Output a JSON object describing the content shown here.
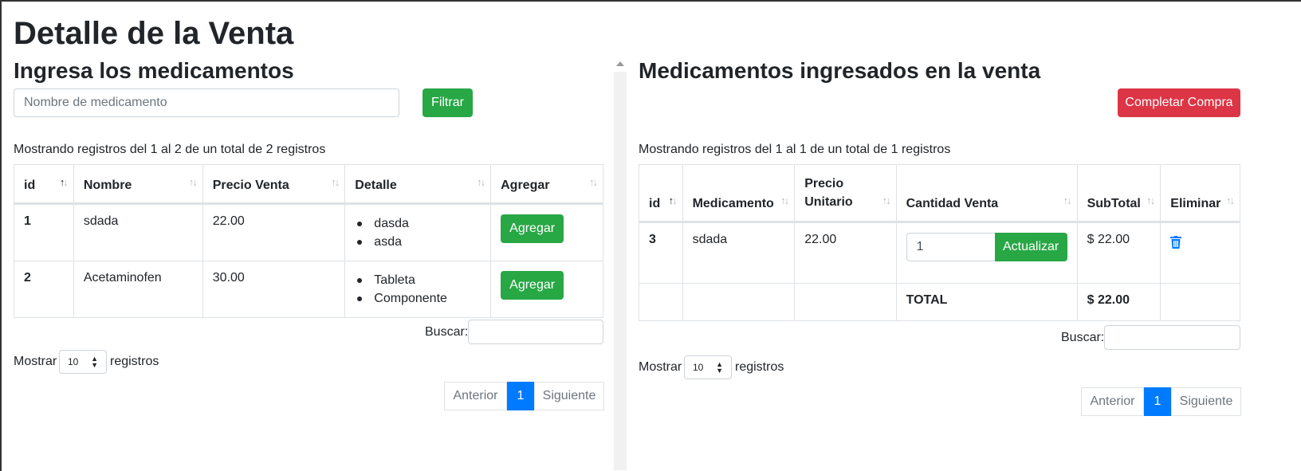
{
  "page": {
    "title": "Detalle de la Venta"
  },
  "left": {
    "heading": "Ingresa los medicamentos",
    "search_placeholder": "Nombre de medicamento",
    "filter_label": "Filtrar",
    "info": "Mostrando registros del 1 al 2 de un total de 2 registros",
    "columns": [
      "id",
      "Nombre",
      "Precio Venta",
      "Detalle",
      "Agregar"
    ],
    "rows": [
      {
        "id": "1",
        "nombre": "sdada",
        "precio": "22.00",
        "detalle": [
          "dasda",
          "asda"
        ],
        "action": "Agregar"
      },
      {
        "id": "2",
        "nombre": "Acetaminofen",
        "precio": "30.00",
        "detalle": [
          "Tableta",
          "Componente"
        ],
        "action": "Agregar"
      }
    ],
    "search_label": "Buscar:",
    "show_label": "Mostrar",
    "show_value": "10",
    "records_label": "registros",
    "pager": {
      "prev": "Anterior",
      "page": "1",
      "next": "Siguiente"
    }
  },
  "right": {
    "heading": "Medicamentos ingresados en la venta",
    "complete_label": "Completar Compra",
    "info": "Mostrando registros del 1 al 1 de un total de 1 registros",
    "columns": [
      "id",
      "Medicamento",
      "Precio Unitario",
      "Cantidad Venta",
      "SubTotal",
      "Eliminar"
    ],
    "rows": [
      {
        "id": "3",
        "medicamento": "sdada",
        "precio": "22.00",
        "cantidad": "1",
        "update": "Actualizar",
        "subtotal": "$ 22.00"
      }
    ],
    "total_label": "TOTAL",
    "total_value": "$ 22.00",
    "search_label": "Buscar:",
    "show_label": "Mostrar",
    "show_value": "10",
    "records_label": "registros",
    "pager": {
      "prev": "Anterior",
      "page": "1",
      "next": "Siguiente"
    }
  },
  "colors": {
    "green": "#28a745",
    "red": "#dc3545",
    "blue": "#007bff"
  },
  "icons": {
    "sort": "sort-arrows-icon",
    "delete": "trash-icon",
    "select": "select-caret-icon"
  }
}
